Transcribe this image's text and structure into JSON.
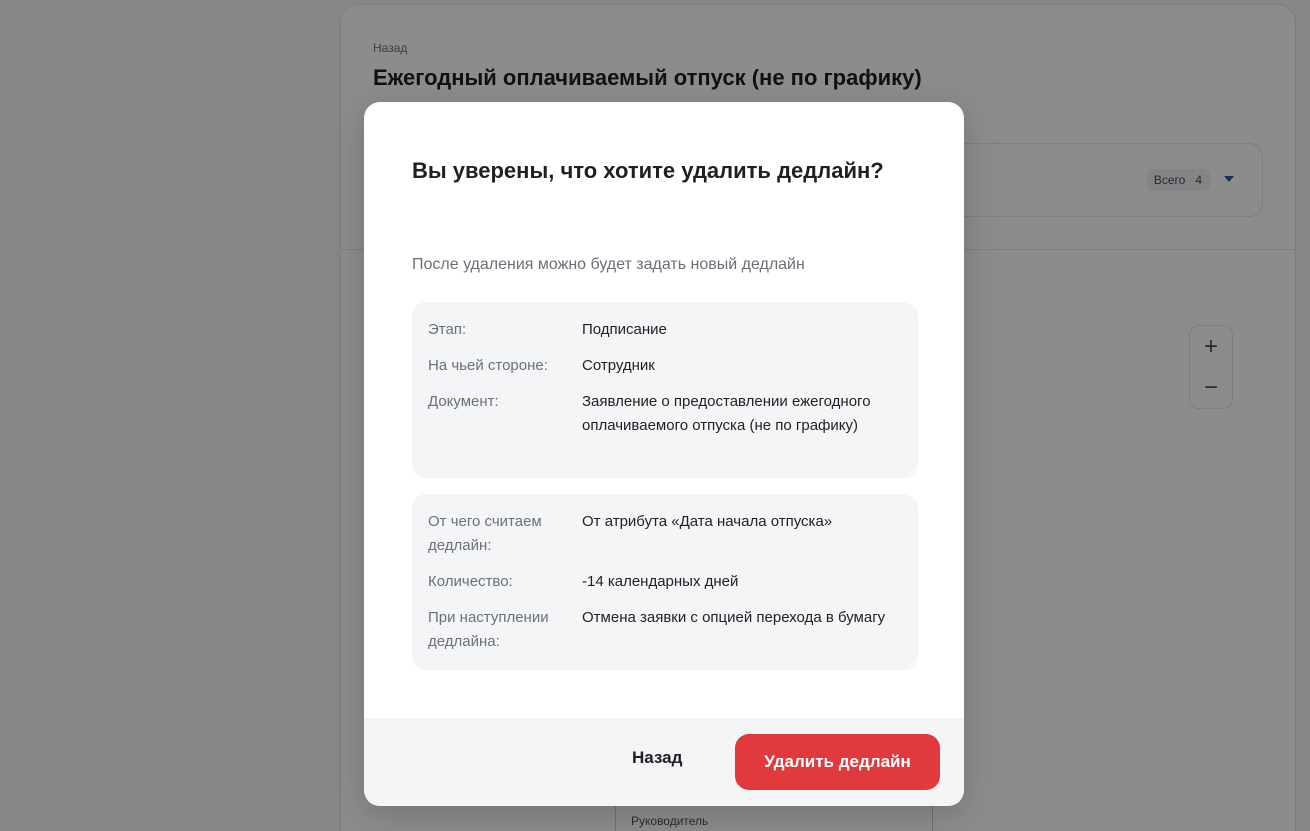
{
  "background": {
    "back_link": "Назад",
    "page_title": "Ежегодный оплачиваемый отпуск (не по графику)",
    "total_label": "Всего",
    "total_count": "4",
    "zoom_in": "+",
    "zoom_out": "−",
    "flow_node_label": "Руководитель"
  },
  "modal": {
    "title": "Вы уверены, что хотите удалить дедлайн?",
    "subtitle": "После удаления можно будет задать новый дедлайн",
    "details_primary": [
      {
        "label": "Этап:",
        "value": "Подписание"
      },
      {
        "label": "На чьей стороне:",
        "value": "Сотрудник"
      },
      {
        "label": "Документ:",
        "value": "Заявление о предоставлении ежегодного оплачиваемого отпуска (не по графику)"
      }
    ],
    "details_secondary": [
      {
        "label": "От чего считаем дедлайн:",
        "value": "От атрибута «Дата начала отпуска»"
      },
      {
        "label": "Количество:",
        "value": "-14 календарных дней"
      },
      {
        "label": "При наступлении дедлайна:",
        "value": "Отмена заявки с опцией перехода в бумагу"
      }
    ],
    "back_button": "Назад",
    "delete_button": "Удалить дедлайн"
  },
  "colors": {
    "danger": "#e0393e",
    "accent": "#3b4fb0",
    "overlay": "rgba(0,0,0,0.45)"
  },
  "icons": {
    "expand": "chevron-down-icon",
    "zoom_in": "plus-icon",
    "zoom_out": "minus-icon"
  }
}
